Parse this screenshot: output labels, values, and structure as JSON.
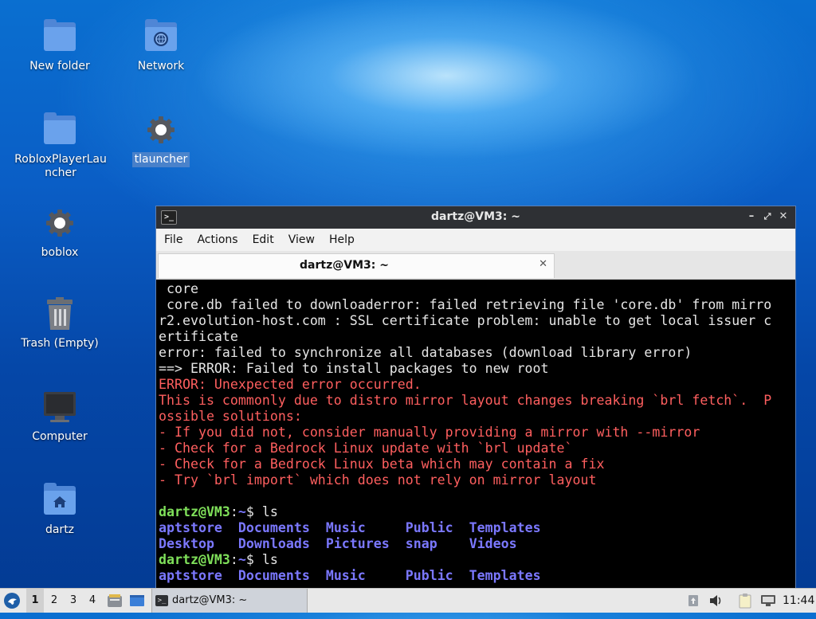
{
  "desktop": {
    "icons": [
      {
        "label": "New folder",
        "icon": "folder-icon"
      },
      {
        "label": "Network",
        "icon": "network-folder-icon"
      },
      {
        "label": "RobloxPlayerLauncher",
        "icon": "folder-icon"
      },
      {
        "label": "tlauncher",
        "icon": "gear-icon"
      },
      {
        "label": "boblox",
        "icon": "gear-icon"
      },
      {
        "label": "Trash (Empty)",
        "icon": "trash-icon"
      },
      {
        "label": "Computer",
        "icon": "monitor-icon"
      },
      {
        "label": "dartz",
        "icon": "home-folder-icon"
      }
    ]
  },
  "window": {
    "title": "dartz@VM3: ~",
    "menu": [
      "File",
      "Actions",
      "Edit",
      "View",
      "Help"
    ],
    "tab_label": "dartz@VM3: ~",
    "terminal": {
      "lines_plain": [
        " core",
        " core.db failed to downloaderror: failed retrieving file 'core.db' from mirro",
        "r2.evolution-host.com : SSL certificate problem: unable to get local issuer c",
        "ertificate",
        "error: failed to synchronize all databases (download library error)",
        "==> ERROR: Failed to install packages to new root"
      ],
      "lines_red": [
        "ERROR: Unexpected error occurred.",
        "This is commonly due to distro mirror layout changes breaking `brl fetch`.  P",
        "ossible solutions:",
        "- If you did not, consider manually providing a mirror with --mirror",
        "- Check for a Bedrock Linux update with `brl update`",
        "- Check for a Bedrock Linux beta which may contain a fix",
        "- Try `brl import` which does not rely on mirror layout"
      ],
      "prompt_user": "dartz@VM3",
      "prompt_sep": ":",
      "prompt_path": "~",
      "prompt_cmd": "$ ls",
      "ls_row1": [
        "aptstore",
        "Documents",
        "Music",
        "Public",
        "Templates"
      ],
      "ls_row2": [
        "Desktop",
        "Downloads",
        "Pictures",
        "snap",
        "Videos"
      ]
    }
  },
  "taskbar": {
    "workspaces": [
      "1",
      "2",
      "3",
      "4"
    ],
    "active_workspace": "1",
    "task_label": "dartz@VM3: ~",
    "clock": "11:44"
  },
  "colors": {
    "terminal_bg": "#000000",
    "error_red": "#ff5f5f",
    "prompt_green": "#7fe05a",
    "dir_blue": "#7b78ff"
  }
}
